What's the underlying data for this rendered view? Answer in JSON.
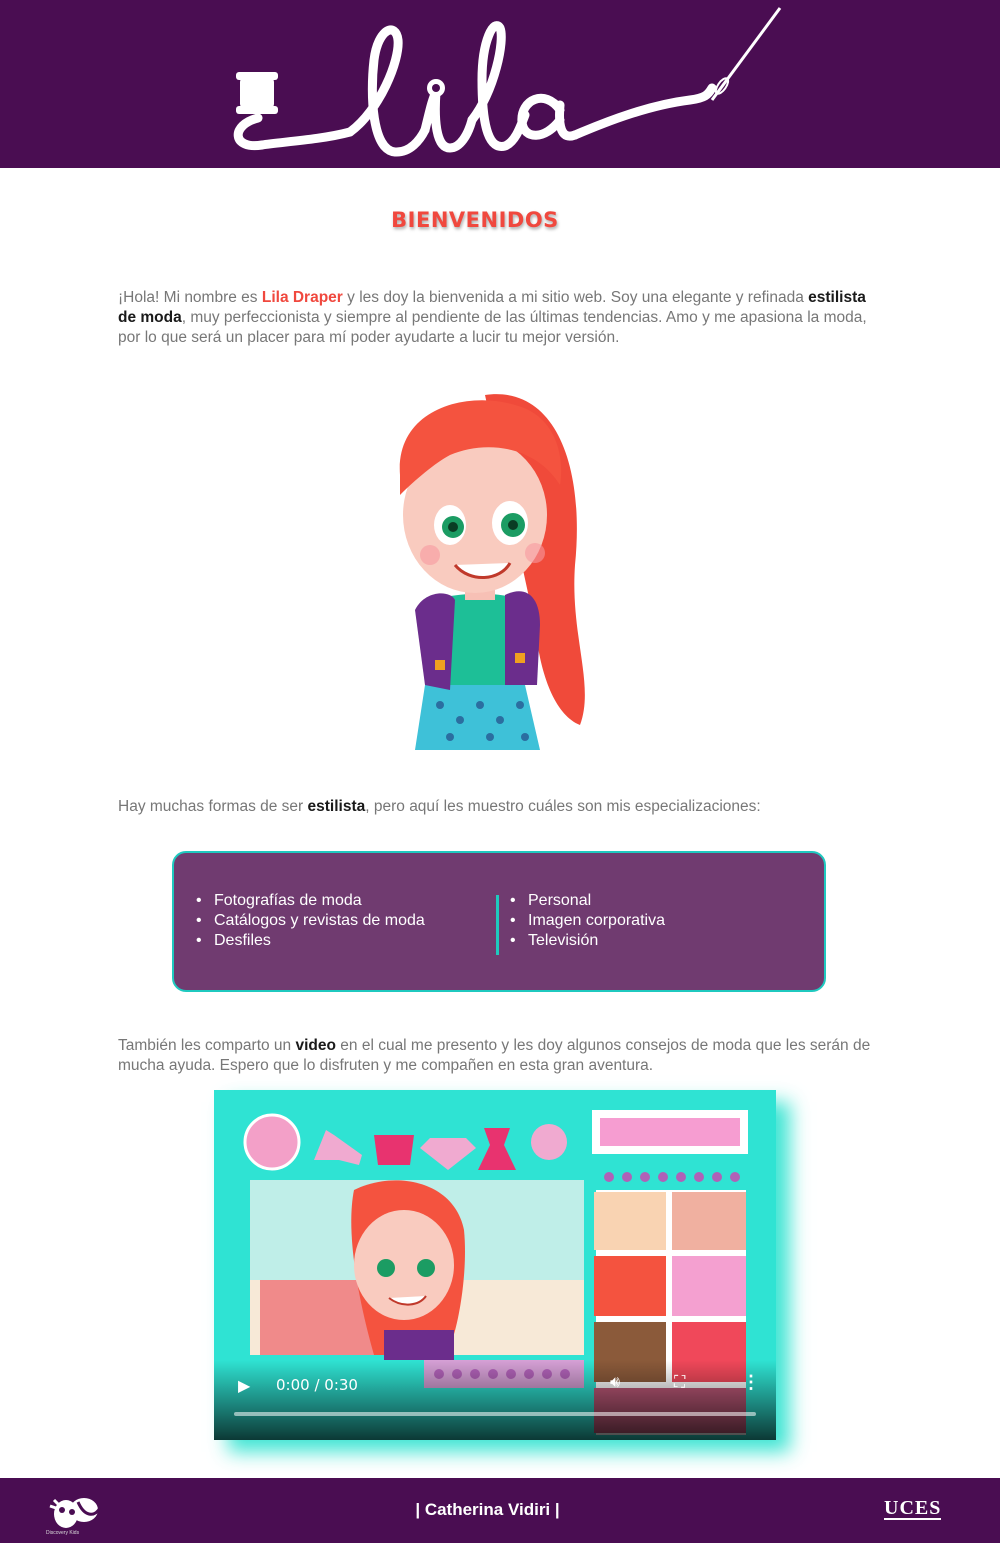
{
  "header": {
    "logo_text": "Lila",
    "colors": {
      "background": "#4a0d52",
      "logo": "#ffffff"
    }
  },
  "welcome": {
    "title": "BIENVENIDOS",
    "color": "#f0483e"
  },
  "intro": {
    "part1": "¡Hola! Mi nombre es ",
    "name": "Lila Draper",
    "part2": " y les doy la bienvenida a mi sitio web. Soy una elegante y refinada ",
    "bold": "estilista de moda",
    "part3": ", muy perfeccionista y siempre al pendiente de las últimas tendencias. Amo y me apasiona la moda, por lo que será un placer para mí poder ayudarte a lucir tu mejor versión."
  },
  "specializations": {
    "intro_part1": "Hay muchas formas de ser ",
    "intro_bold": "estilista",
    "intro_part2": ", pero aquí les muestro cuáles son mis especializaciones:",
    "left": [
      "Fotografías de moda",
      "Catálogos y revistas de moda",
      "Desfiles"
    ],
    "right": [
      "Personal",
      "Imagen corporativa",
      "Televisión"
    ],
    "colors": {
      "box": "#703b70",
      "border": "#1fc9bf"
    }
  },
  "video_section": {
    "text_part1": "También les comparto un ",
    "text_bold": "video",
    "text_part2": " en el cual me presento y les doy algunos consejos de moda que les serán de mucha ayuda. Espero que lo disfruten y me compañen en esta gran aventura.",
    "player": {
      "time": "0:00 / 0:30",
      "progress": 0,
      "play_icon": "play-icon",
      "volume_icon": "volume-icon",
      "fullscreen_icon": "fullscreen-icon",
      "more_icon": "more-options-icon"
    },
    "colors": {
      "frame": "#2fe3d3"
    }
  },
  "footer": {
    "credit": "| Catherina Vidiri |",
    "left_logo_caption": "Discovery Kids",
    "right_logo": "UCES"
  }
}
